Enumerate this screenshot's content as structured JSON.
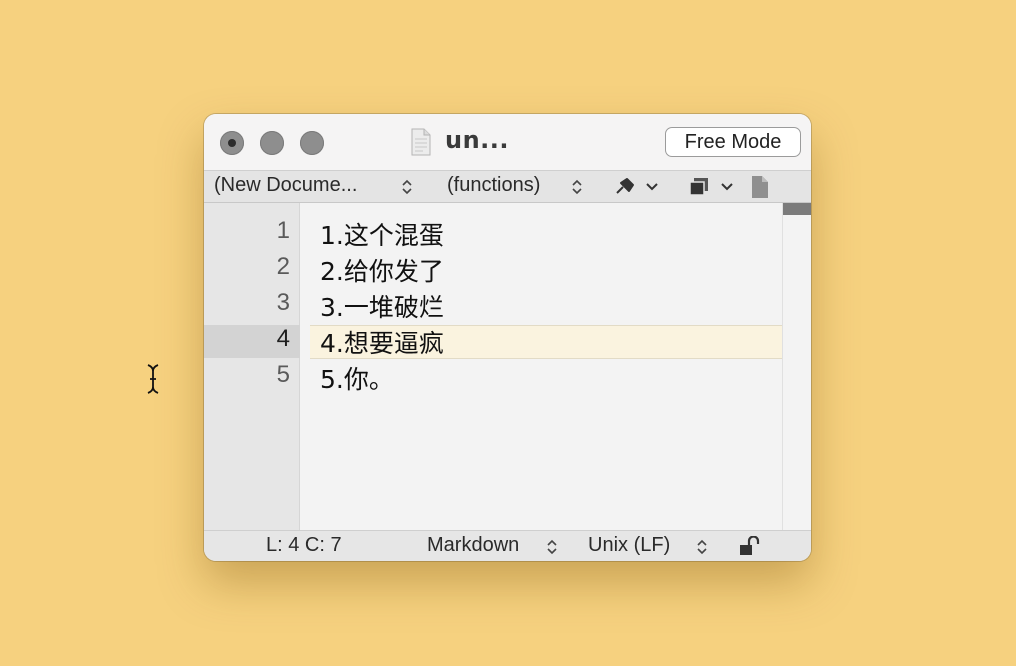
{
  "window": {
    "title": "un...",
    "mode_button": "Free Mode"
  },
  "toolbar": {
    "document_popup": "(New Docume...",
    "functions_popup": "(functions)",
    "updown_glyph": "⌃⌄"
  },
  "editor": {
    "line_numbers": [
      "1",
      "2",
      "3",
      "4",
      "5"
    ],
    "current_line": 4,
    "lines": [
      "1.这个混蛋",
      "2.给你发了",
      "3.一堆破烂",
      "4.想要逼疯",
      "5.你。"
    ]
  },
  "status": {
    "position": "L: 4 C: 7",
    "syntax": "Markdown",
    "line_endings": "Unix (LF)"
  },
  "colors": {
    "background": "#f6d17f",
    "current_line_highlight": "#faf3df"
  }
}
